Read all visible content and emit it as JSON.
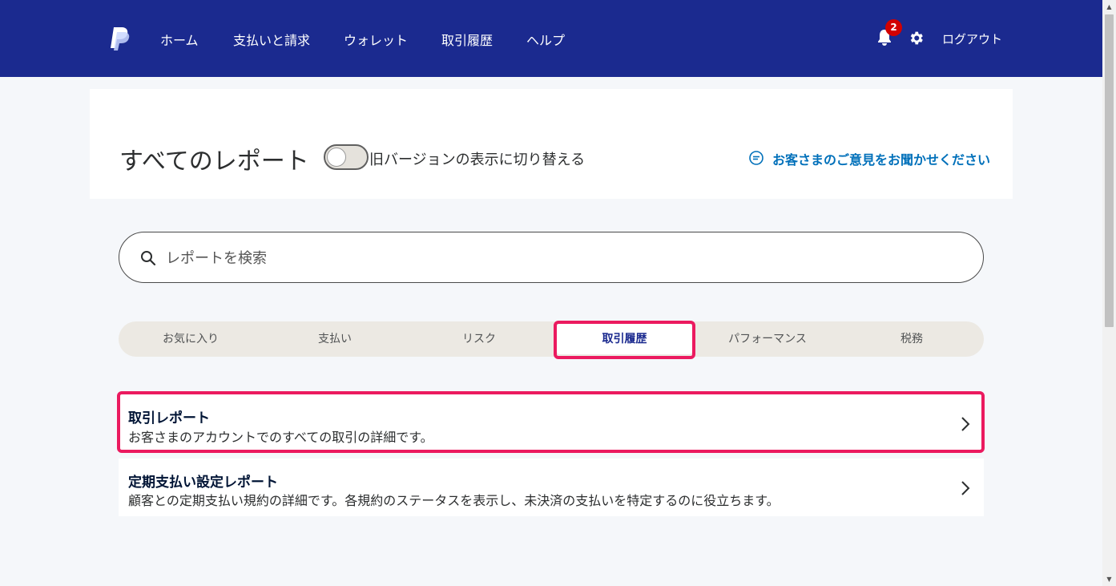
{
  "header": {
    "logo": "paypal-logo",
    "nav": [
      "ホーム",
      "支払いと請求",
      "ウォレット",
      "取引履歴",
      "ヘルプ"
    ],
    "notification_count": "2",
    "logout_label": "ログアウト",
    "background_color": "#1b2a8f"
  },
  "page": {
    "title": "すべてのレポート",
    "toggle_label": "旧バージョンの表示に切り替える",
    "toggle_on": false,
    "feedback_label": "お客さまのご意見をお聞かせください"
  },
  "search": {
    "placeholder": "レポートを検索"
  },
  "tabs": {
    "items": [
      "お気に入り",
      "支払い",
      "リスク",
      "取引履歴",
      "パフォーマンス",
      "税務"
    ],
    "active": "取引履歴"
  },
  "reports": [
    {
      "title": "取引レポート",
      "description": "お客さまのアカウントでのすべての取引の詳細です。"
    },
    {
      "title": "定期支払い設定レポート",
      "description": "顧客との定期支払い規約の詳細です。各規約のステータスを表示し、未決済の支払いを特定するのに役立ちます。"
    }
  ],
  "colors": {
    "accent": "#0070ba",
    "highlight": "#eb1a5f",
    "badge": "#d20000"
  }
}
